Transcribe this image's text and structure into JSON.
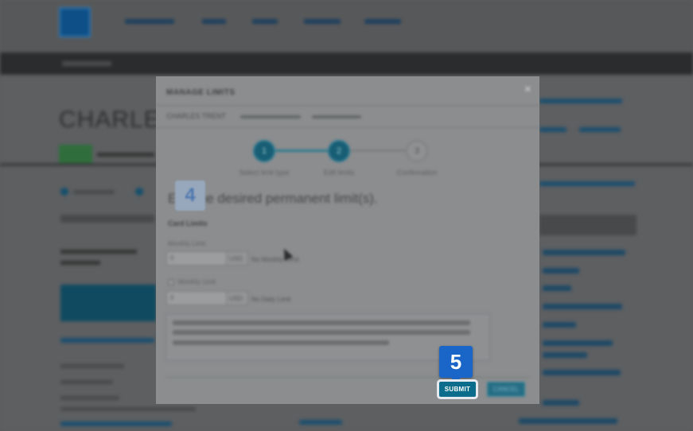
{
  "background": {
    "page_title": "CHARLES"
  },
  "modal": {
    "title": "MANAGE LIMITS",
    "close_glyph": "×",
    "breadcrumb_name": "CHARLES TRENT",
    "steps": [
      {
        "number": "1",
        "label": "Select limit type",
        "state": "done"
      },
      {
        "number": "2",
        "label": "Edit limits",
        "state": "done"
      },
      {
        "number": "3",
        "label": "Confirmation",
        "state": "todo"
      }
    ],
    "heading": "Edit the desired permanent limit(s).",
    "section": "Card Limits",
    "monthly": {
      "label": "Monthly Limit",
      "value": "0",
      "unit": "USD",
      "help": "No Monthly Limit"
    },
    "monthly2": {
      "label": "Monthly Limit",
      "value": "0",
      "unit": "USD",
      "help": "No Daily Limit"
    },
    "cancel_label": "CANCEL"
  },
  "annotations": {
    "marker_4": "4",
    "marker_5": "5"
  },
  "submit_label": "SUBMIT",
  "colors": {
    "accent": "#0b6c8c",
    "marker": "#1a66c8"
  }
}
